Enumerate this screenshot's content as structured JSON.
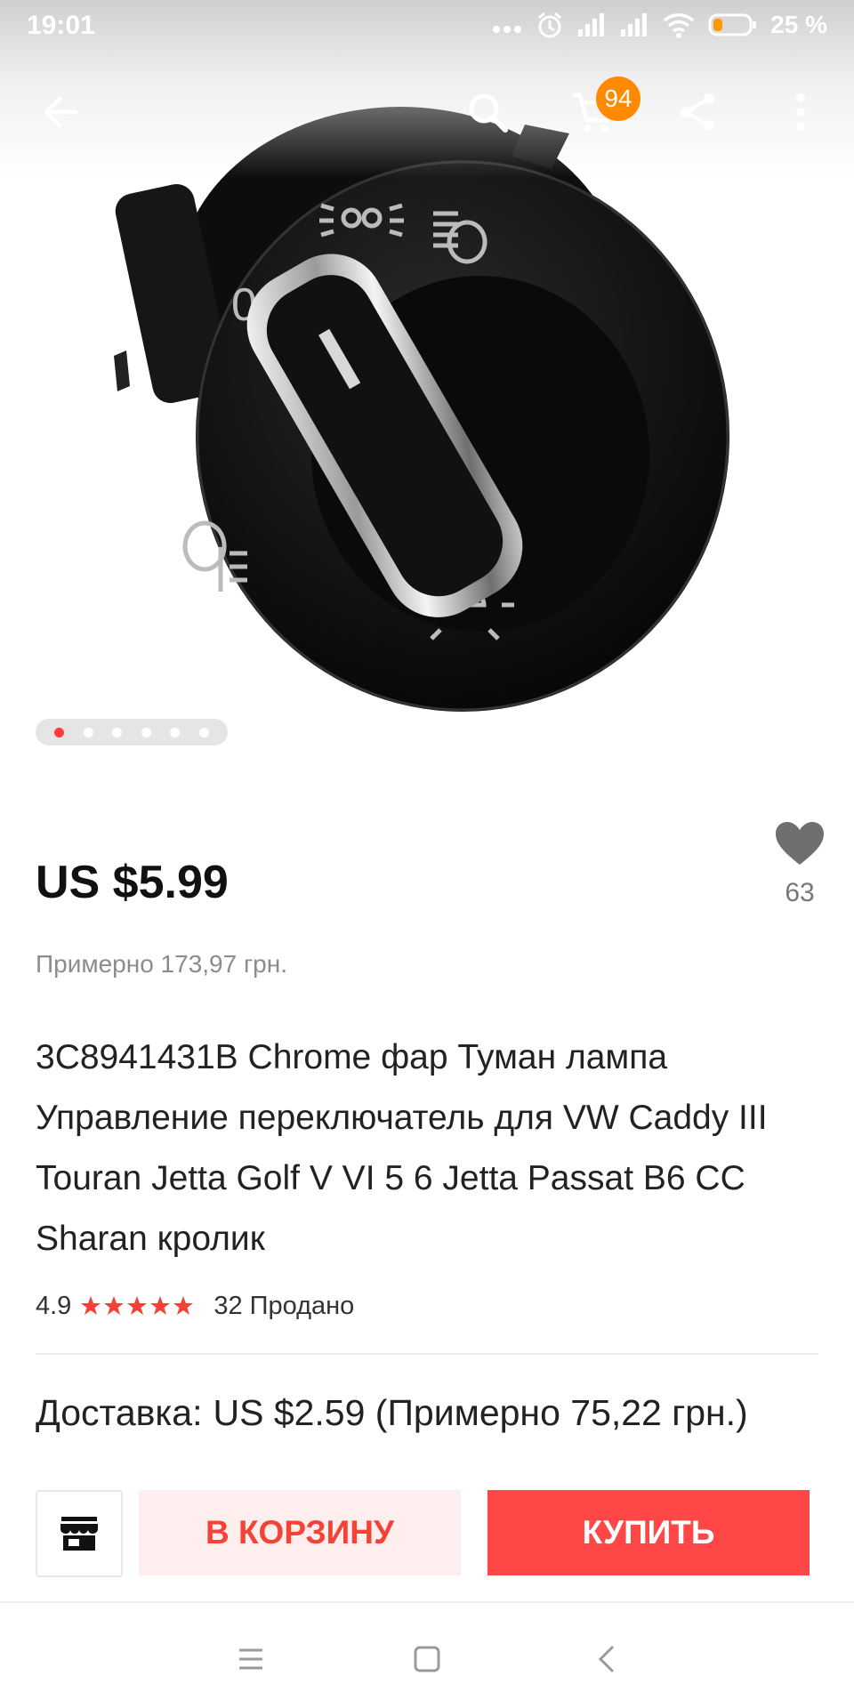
{
  "status_bar": {
    "time": "19:01",
    "battery": "25 %"
  },
  "app_bar": {
    "cart_count": "94",
    "icons": [
      "back-arrow-icon",
      "search-icon",
      "cart-icon",
      "share-icon",
      "more-vertical-icon"
    ]
  },
  "gallery": {
    "image_count": 6,
    "active_index": 0
  },
  "product": {
    "price": "US $5.99",
    "approx_price": "Примерно 173,97 грн.",
    "wishlist_count": "63",
    "title": "3C8941431B Chrome фар Туман лампа Управление переключатель для VW Caddy III Touran Jetta Golf V VI 5 6 Jetta Passat B6 CC Sharan кролик",
    "rating": "4.9",
    "stars": 5,
    "sold": "32 Продано"
  },
  "delivery": {
    "label": "Доставка:",
    "value": "US $2.59 (Примерно 75,22 грн.)"
  },
  "actions": {
    "add_to_cart": "В КОРЗИНУ",
    "buy": "КУПИТЬ"
  },
  "colors": {
    "accent_red": "#ff4747",
    "cart_btn_bg": "#ffeeee",
    "cart_btn_text": "#f44336",
    "badge_orange": "#ff8a00",
    "star_red": "#f44336"
  }
}
